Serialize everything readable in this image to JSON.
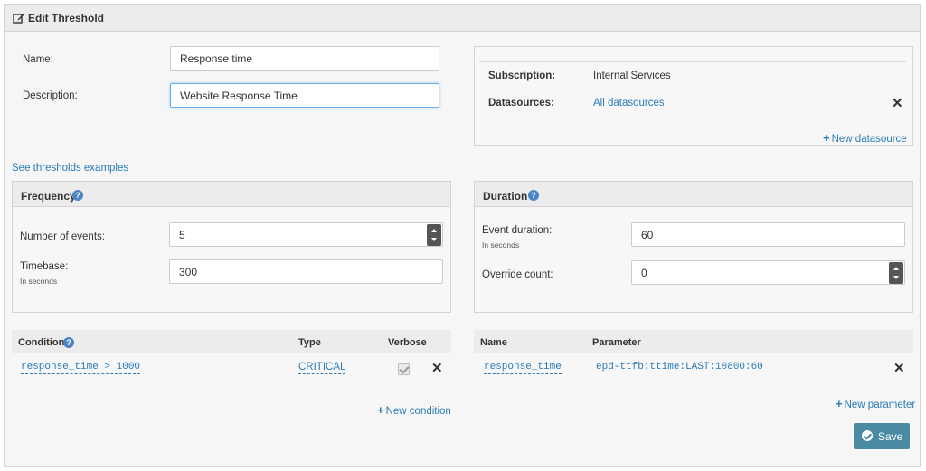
{
  "header": {
    "title": "Edit Threshold",
    "icon": "edit-icon"
  },
  "form": {
    "name_label": "Name:",
    "name_value": "Response time",
    "description_label": "Description:",
    "description_value": "Website Response Time"
  },
  "info": {
    "subscription_label": "Subscription:",
    "subscription_value": "Internal Services",
    "datasources_label": "Datasources:",
    "datasources_value": "All datasources",
    "new_datasource": "New datasource"
  },
  "examples_link": "See thresholds examples",
  "frequency": {
    "title": "Frequency",
    "events_label": "Number of events:",
    "events_value": "5",
    "timebase_label": "Timebase:",
    "timebase_sub": "In seconds",
    "timebase_value": "300"
  },
  "duration": {
    "title": "Duration",
    "event_label": "Event duration:",
    "event_sub": "In seconds",
    "event_value": "60",
    "override_label": "Override count:",
    "override_value": "0"
  },
  "conditions": {
    "headers": {
      "condition": "Condition",
      "type": "Type",
      "verbose": "Verbose"
    },
    "rows": [
      {
        "condition": "response_time > 1000",
        "type": "CRITICAL",
        "verbose": true
      }
    ],
    "new_condition": "New condition"
  },
  "parameters": {
    "headers": {
      "name": "Name",
      "parameter": "Parameter"
    },
    "rows": [
      {
        "name": "response_time",
        "parameter": "epd-ttfb:ttime:LAST:10800:60"
      }
    ],
    "new_parameter": "New parameter"
  },
  "save_label": "Save",
  "colors": {
    "accent": "#2a7bb8",
    "save": "#4b8aa3",
    "help": "#4a86c5"
  }
}
